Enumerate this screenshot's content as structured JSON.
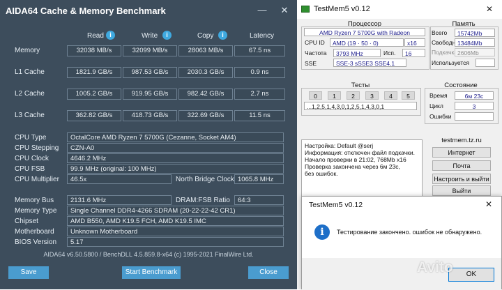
{
  "aida": {
    "title": "AIDA64 Cache & Memory Benchmark",
    "columns": [
      "Read",
      "Write",
      "Copy",
      "Latency"
    ],
    "rows": [
      {
        "label": "Memory",
        "values": [
          "32038 MB/s",
          "32099 MB/s",
          "28063 MB/s",
          "67.5 ns"
        ]
      },
      {
        "label": "L1 Cache",
        "values": [
          "1821.9 GB/s",
          "987.53 GB/s",
          "2030.3 GB/s",
          "0.9 ns"
        ]
      },
      {
        "label": "L2 Cache",
        "values": [
          "1005.2 GB/s",
          "919.95 GB/s",
          "982.42 GB/s",
          "2.7 ns"
        ]
      },
      {
        "label": "L3 Cache",
        "values": [
          "362.82 GB/s",
          "418.73 GB/s",
          "322.69 GB/s",
          "11.5 ns"
        ]
      }
    ],
    "cpu_type_label": "CPU Type",
    "cpu_type": "OctalCore AMD Ryzen 7 5700G  (Cezanne, Socket AM4)",
    "cpu_stepping_label": "CPU Stepping",
    "cpu_stepping": "CZN-A0",
    "cpu_clock_label": "CPU Clock",
    "cpu_clock": "4646.2 MHz",
    "cpu_fsb_label": "CPU FSB",
    "cpu_fsb": "99.9 MHz  (original: 100 MHz)",
    "cpu_mult_label": "CPU Multiplier",
    "cpu_mult": "46.5x",
    "nb_clock_label": "North Bridge Clock",
    "nb_clock": "1065.8 MHz",
    "mem_bus_label": "Memory Bus",
    "mem_bus": "2131.6 MHz",
    "dram_ratio_label": "DRAM:FSB Ratio",
    "dram_ratio": "64:3",
    "mem_type_label": "Memory Type",
    "mem_type": "Single Channel DDR4-4266 SDRAM  (20-22-22-42 CR1)",
    "chipset_label": "Chipset",
    "chipset": "AMD B550, AMD K19.5 FCH, AMD K19.5 IMC",
    "motherboard_label": "Motherboard",
    "motherboard": "Unknown Motherboard",
    "bios_label": "BIOS Version",
    "bios": "5.17",
    "footer": "AIDA64 v6.50.5800 / BenchDLL 4.5.859.8-x64  (c) 1995-2021 FinalWire Ltd.",
    "save": "Save",
    "start": "Start Benchmark",
    "close": "Close"
  },
  "testmem": {
    "title": "TestMem5 v0.12",
    "cpu_group": "Процессор",
    "cpu_name": "AMD Ryzen 7 5700G with Radeon",
    "cpu_id_label": "CPU ID",
    "cpu_id": "AMD  (19 · 50 · 0)",
    "cpu_bits": "x16",
    "freq_label": "Частота",
    "freq": "3793 MHz",
    "used_label": "Исп.",
    "used": "16",
    "sse_label": "SSE",
    "sse": "SSE-3 sSSE3 SSE4.1",
    "mem_group": "Память",
    "total_label": "Всего",
    "total": "15742Mb",
    "free_label": "Свободно",
    "free": "13484Mb",
    "swap_label": "Подкачка",
    "swap": "2606Mb",
    "used_mem_label": "Используется",
    "used_mem": "",
    "tests_group": "Тесты",
    "tests": [
      "0",
      "1",
      "2",
      "3",
      "4",
      "5"
    ],
    "test_seq": "...1,2,5,1,4,3,0,1,2,5,1,4,3,0,1",
    "state_group": "Состояние",
    "time_label": "Время",
    "time": "6м 23с",
    "cycle_label": "Цикл",
    "cycle": "3",
    "errors_label": "Ошибки",
    "errors": "",
    "log": [
      "Настройка: Default @serj",
      "Информация: отключен файл подкачки.",
      "Начало проверки в 21:02, 768Mb x16",
      "Проверка закончена через 6м 23с,",
      "без ошибок."
    ],
    "site": "testmem.tz.ru",
    "btn_internet": "Интернет",
    "btn_mail": "Почта",
    "btn_settings": "Настроить и выйти",
    "btn_exit": "Выйти"
  },
  "dialog": {
    "title": "TestMem5 v0.12",
    "message": "Тестирование закончено. ошибок не обнаружено.",
    "ok": "OK"
  },
  "watermark": "Avito",
  "colors": {
    "aida_bg": "#3d4d5c",
    "aida_button": "#4a9ccf",
    "info_icon": "#3fa9e0",
    "testmem_bg": "#f0f0f0"
  }
}
